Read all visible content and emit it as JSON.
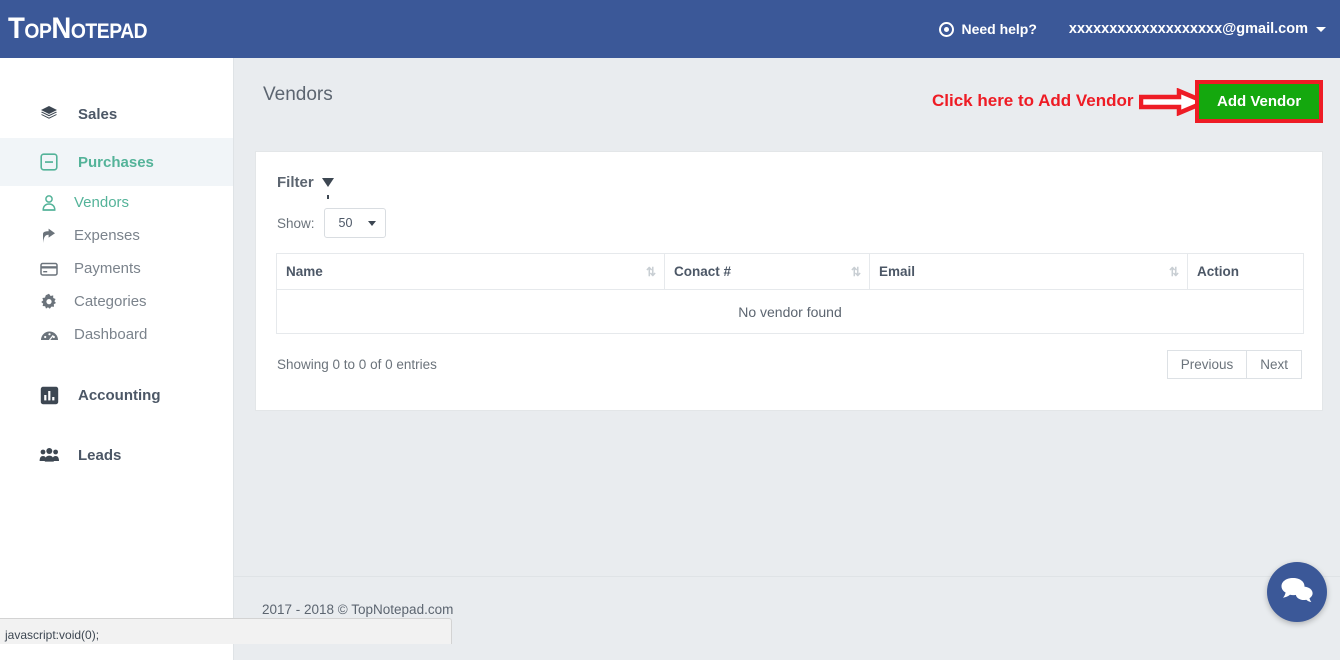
{
  "header": {
    "logo": "TopNotepad",
    "need_help": "Need help?",
    "need_help_icon": "lifering-icon",
    "user_email": "xxxxxxxxxxxxxxxxxxx@gmail.com",
    "caret_icon": "caret-down-icon",
    "background_color": "#3b5898"
  },
  "sidebar": {
    "items": [
      {
        "label": "Sales",
        "icon": "layers-icon",
        "active": false
      },
      {
        "label": "Purchases",
        "icon": "minus-square-icon",
        "active": true
      },
      {
        "label": "Accounting",
        "icon": "bar-chart-icon",
        "active": false
      },
      {
        "label": "Leads",
        "icon": "users-group-icon",
        "active": false
      }
    ],
    "purchases_sub_items": [
      {
        "label": "Vendors",
        "icon": "user-vendor-icon",
        "active": true
      },
      {
        "label": "Expenses",
        "icon": "share-arrow-icon",
        "active": false
      },
      {
        "label": "Payments",
        "icon": "credit-card-icon",
        "active": false
      },
      {
        "label": "Categories",
        "icon": "gear-icon",
        "active": false
      },
      {
        "label": "Dashboard",
        "icon": "speedometer-icon",
        "active": false
      }
    ],
    "active_color": "#54b399"
  },
  "main": {
    "page_title": "Vendors",
    "add_button_label": "Add Vendor",
    "add_button_color": "#14a80e",
    "annotation_text": "Click here to Add Vendor",
    "annotation_color": "#ee1c25",
    "annotation_arrow_icon": "right-arrow-annotation-icon"
  },
  "panel": {
    "filter_label": "Filter",
    "filter_icon": "funnel-icon",
    "show_label": "Show:",
    "show_value": "50",
    "show_options": [
      "50"
    ],
    "table": {
      "columns": [
        {
          "label": "Name",
          "sortable": true
        },
        {
          "label": "Conact #",
          "sortable": true
        },
        {
          "label": "Email",
          "sortable": true
        },
        {
          "label": "Action",
          "sortable": false
        }
      ],
      "sort_icon": "sort-updown-icon",
      "empty_message": "No vendor found",
      "rows": []
    },
    "entries_text": "Showing 0 to 0 of 0 entries",
    "previous_label": "Previous",
    "next_label": "Next"
  },
  "footer": {
    "copyright": "2017 - 2018 © TopNotepad.com"
  },
  "chat": {
    "icon": "chat-bubbles-icon",
    "color": "#3b5898"
  },
  "statusbar": {
    "url": "javascript:void(0);"
  }
}
